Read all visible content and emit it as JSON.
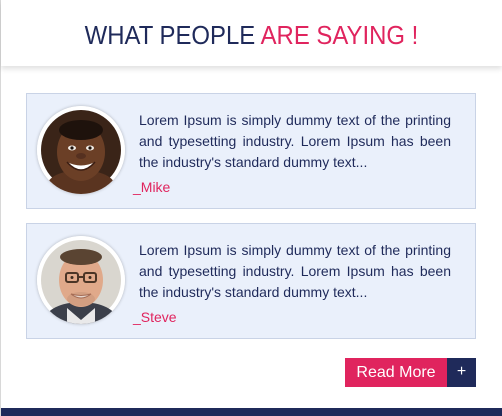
{
  "header": {
    "title_part1": "WHAT PEOPLE ",
    "title_part2": "ARE SAYING !"
  },
  "testimonials": [
    {
      "quote": "Lorem Ipsum is simply dummy text of the printing and typesetting industry. Lorem Ipsum has been the industry's standard dummy text...",
      "author": "_Mike"
    },
    {
      "quote": "Lorem Ipsum is simply dummy text of the printing and typesetting industry. Lorem Ipsum has been the industry's standard dummy text...",
      "author": "_Steve"
    }
  ],
  "actions": {
    "read_more_label": "Read More",
    "read_more_icon": "+"
  },
  "colors": {
    "navy": "#1f2a5a",
    "accent_pink": "#e0245e",
    "card_background": "#eaf0fb"
  }
}
